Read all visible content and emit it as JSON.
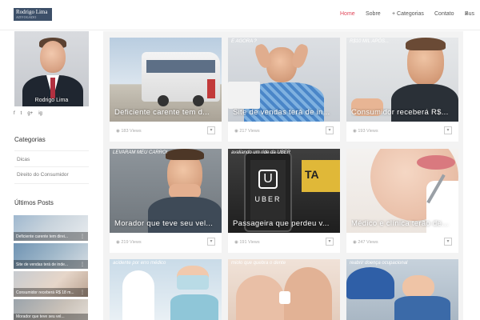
{
  "logo": {
    "title": "Rodrigo Lima",
    "subtitle": "ADVOGADO"
  },
  "nav": {
    "home": "Home",
    "about": "Sobre",
    "categories": "+ Categorias",
    "contact": "Contato",
    "search": "Bus"
  },
  "profile": {
    "name": "Rodrigo Lima"
  },
  "social": [
    "f",
    "t",
    "g+",
    "ig"
  ],
  "sidebar": {
    "categories_title": "Categorias",
    "categories": [
      "Dicas",
      "Direito do Consumidor"
    ],
    "recent_title": "Últimos Posts",
    "recent": [
      "Deficiente carente tem direi...",
      "Site de vendas terá de inde...",
      "Consumidor receberá R$ 18 m...",
      "Morador que teve seu vel..."
    ]
  },
  "cards": [
    {
      "title": "Deficiente carente tem d...",
      "views": "183 Views",
      "caption": ""
    },
    {
      "title": "Site de vendas terá de in...",
      "views": "217 Views",
      "caption": "E AGORA ?"
    },
    {
      "title": "Consumidor receberá R$...",
      "views": "193 Views",
      "caption": "R$10 MIL APÓS..."
    },
    {
      "title": "Morador que teve seu vel...",
      "views": "219 Views",
      "caption": "LEVARAM MEU CARRO!"
    },
    {
      "title": "Passageira que perdeu v...",
      "views": "191 Views",
      "caption": "avaliando um ride da UBER"
    },
    {
      "title": "Médico e clínica terão de...",
      "views": "247 Views",
      "caption": ""
    },
    {
      "title": "",
      "views": "",
      "caption": "acidente por erro médico"
    },
    {
      "title": "",
      "views": "",
      "caption": "miolo que quebra o dente"
    },
    {
      "title": "",
      "views": "",
      "caption": "reabrir doença ocupacional"
    }
  ],
  "uber_text": "UBER",
  "more_icon": "▾",
  "colors": {
    "accent": "#e0485a",
    "logo_bg": "#3d5069"
  }
}
